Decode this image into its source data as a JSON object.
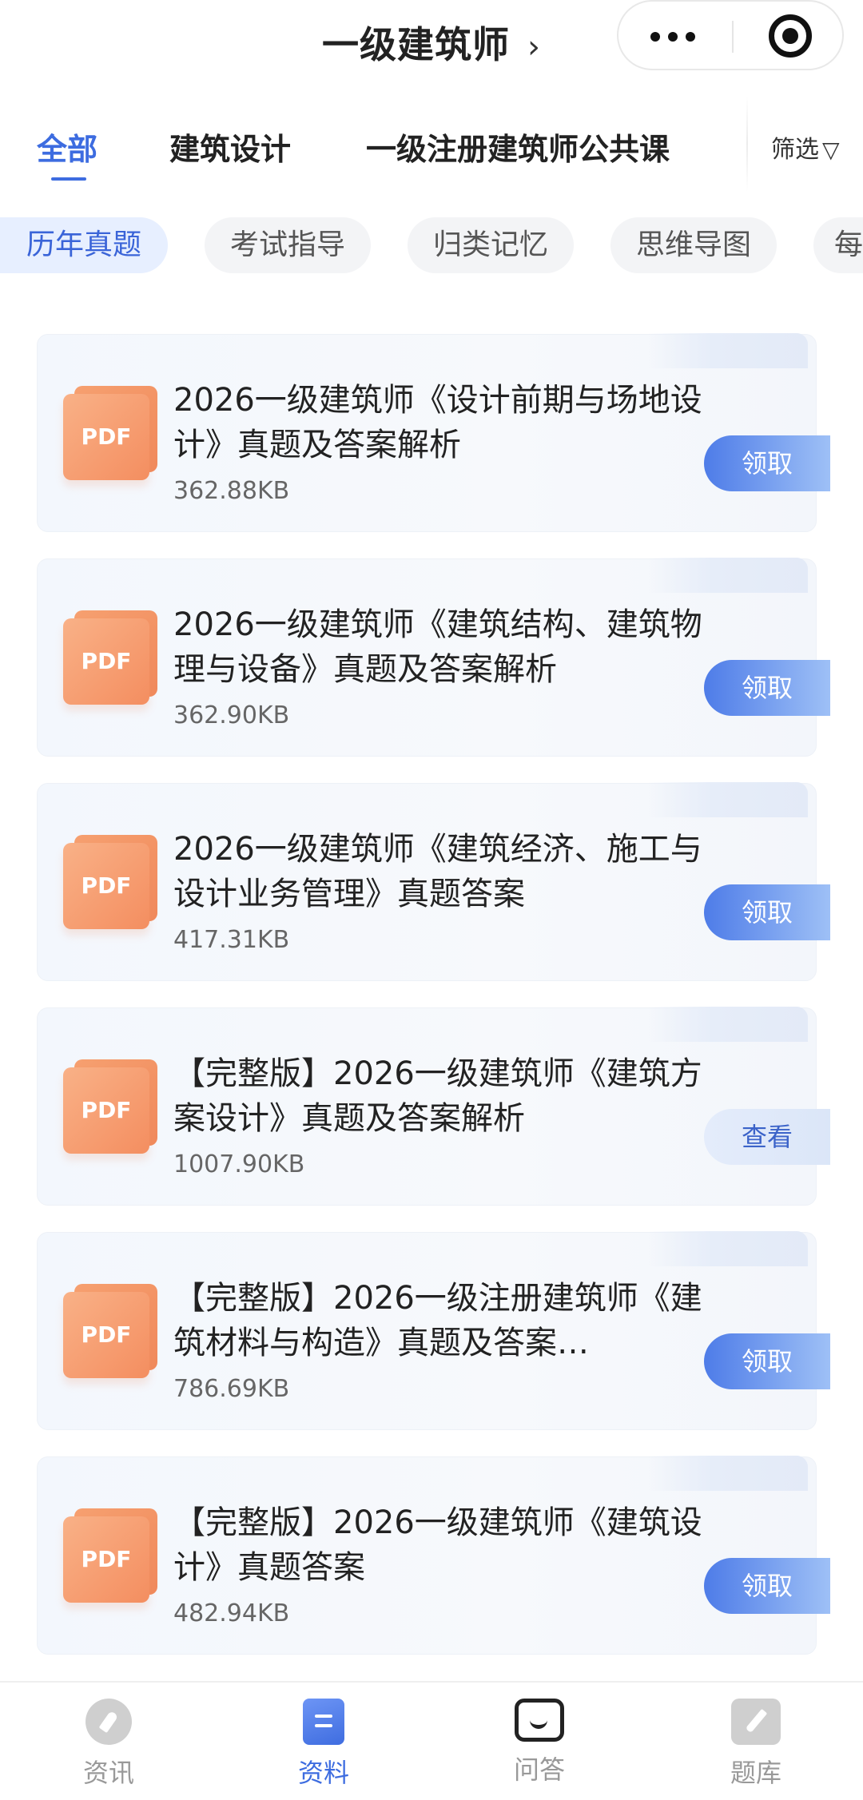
{
  "header": {
    "title": "一级建筑师",
    "chevron": "›"
  },
  "tabs": [
    {
      "label": "全部",
      "active": true
    },
    {
      "label": "建筑设计",
      "active": false
    },
    {
      "label": "一级注册建筑师公共课",
      "active": false
    }
  ],
  "filter": {
    "label": "筛选",
    "icon": "funnel-icon",
    "glyph": "▽"
  },
  "chips": [
    {
      "label": "历年真题",
      "active": true
    },
    {
      "label": "考试指导",
      "active": false
    },
    {
      "label": "归类记忆",
      "active": false
    },
    {
      "label": "思维导图",
      "active": false
    },
    {
      "label": "每",
      "active": false
    }
  ],
  "files": [
    {
      "icon_label": "PDF",
      "title": "2026一级建筑师《设计前期与场地设计》真题及答案解析",
      "size": "362.88KB",
      "action": "领取",
      "action_type": "primary"
    },
    {
      "icon_label": "PDF",
      "title": "2026一级建筑师《建筑结构、建筑物理与设备》真题及答案解析",
      "size": "362.90KB",
      "action": "领取",
      "action_type": "primary"
    },
    {
      "icon_label": "PDF",
      "title": "2026一级建筑师《建筑经济、施工与设计业务管理》真题答案",
      "size": "417.31KB",
      "action": "领取",
      "action_type": "primary"
    },
    {
      "icon_label": "PDF",
      "title": "【完整版】2026一级建筑师《建筑方案设计》真题及答案解析",
      "size": "1007.90KB",
      "action": "查看",
      "action_type": "view"
    },
    {
      "icon_label": "PDF",
      "title": "【完整版】2026一级注册建筑师《建筑材料与构造》真题及答案…",
      "size": "786.69KB",
      "action": "领取",
      "action_type": "primary"
    },
    {
      "icon_label": "PDF",
      "title": "【完整版】2026一级建筑师《建筑设计》真题答案",
      "size": "482.94KB",
      "action": "领取",
      "action_type": "primary"
    }
  ],
  "bottom_nav": [
    {
      "label": "资讯",
      "icon": "compass-icon",
      "active": false
    },
    {
      "label": "资料",
      "icon": "document-icon",
      "active": true
    },
    {
      "label": "问答",
      "icon": "chat-icon",
      "active": false
    },
    {
      "label": "题库",
      "icon": "pen-icon",
      "active": false
    }
  ],
  "colors": {
    "accent": "#3d6ce0",
    "chip_active_bg": "#e7efff",
    "pdf_orange": "#f48e60",
    "card_bg": "#f5f8fc"
  }
}
